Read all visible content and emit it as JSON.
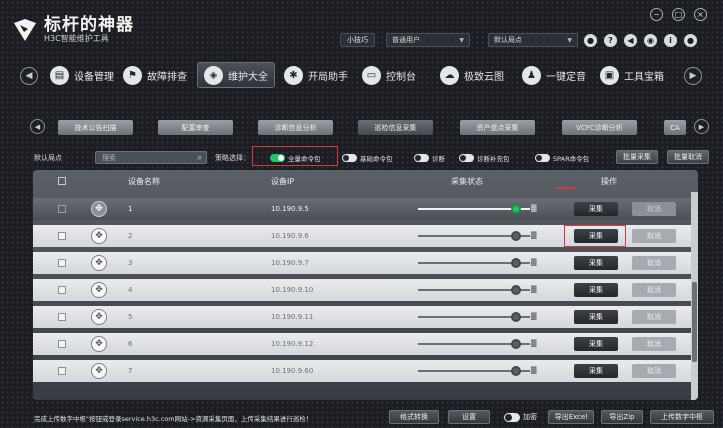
{
  "app": {
    "title": "标杆的神器",
    "subtitle": "H3C智能维护工具"
  },
  "header": {
    "tip_button": "小技巧",
    "user_select": "普通用户",
    "site_select": "默认局点",
    "window_controls": [
      "⊖",
      "⊕",
      "⊗"
    ],
    "icons": [
      "person-icon",
      "help-icon",
      "back-icon",
      "settings-icon",
      "info-icon",
      "pin-icon"
    ]
  },
  "nav": {
    "items": [
      {
        "label": "设备管理",
        "icon": "device-icon"
      },
      {
        "label": "故障排查",
        "icon": "troubleshoot-icon"
      },
      {
        "label": "维护大全",
        "icon": "shield-icon",
        "active": true
      },
      {
        "label": "开局助手",
        "icon": "gear-icon"
      },
      {
        "label": "控制台",
        "icon": "console-icon"
      },
      {
        "label": "极致云图",
        "icon": "cloud-icon"
      },
      {
        "label": "一键定音",
        "icon": "person-icon"
      },
      {
        "label": "工具宝箱",
        "icon": "toolbox-icon"
      }
    ]
  },
  "subtabs": [
    {
      "label": "技术公告扫描"
    },
    {
      "label": "配置审查"
    },
    {
      "label": "诊断信息分析"
    },
    {
      "label": "巡检信息采集",
      "active": true
    },
    {
      "label": "资产盘点采集"
    },
    {
      "label": "VCFC诊断分析"
    },
    {
      "label": "CA"
    }
  ],
  "filter": {
    "site_label": "默认局点",
    "search_placeholder": "搜索",
    "strategy_label": "策略选择：",
    "toggles": [
      {
        "label": "全量命令包",
        "on": true
      },
      {
        "label": "基础命令包",
        "on": false
      },
      {
        "label": "诊断",
        "on": false
      },
      {
        "label": "诊断补充包",
        "on": false
      },
      {
        "label": "SPAR命令包",
        "on": false
      }
    ],
    "batch_collect": "批量采集",
    "batch_cancel": "批量取消"
  },
  "table": {
    "headers": {
      "name": "设备名称",
      "ip": "设备IP",
      "status": "采集状态",
      "action": "操作"
    },
    "rows": [
      {
        "name": "1",
        "ip": "10.190.9.5",
        "collect": "采集",
        "cancel": "取消",
        "selected": true
      },
      {
        "name": "2",
        "ip": "10.190.9.6",
        "collect": "采集",
        "cancel": "取消"
      },
      {
        "name": "3",
        "ip": "10.190.9.7",
        "collect": "采集",
        "cancel": "取消"
      },
      {
        "name": "4",
        "ip": "10.190.9.10",
        "collect": "采集",
        "cancel": "取消"
      },
      {
        "name": "5",
        "ip": "10.190.9.11",
        "collect": "采集",
        "cancel": "取消"
      },
      {
        "name": "6",
        "ip": "10.190.9.12",
        "collect": "采集",
        "cancel": "取消"
      },
      {
        "name": "7",
        "ip": "10.190.9.60",
        "collect": "采集",
        "cancel": "取消"
      }
    ]
  },
  "footer": {
    "hint": "完成上传数字中枢\"按钮或登录service.h3c.com网站->资源采集页面，上传采集结果进行巡检！",
    "format_convert": "格式转换",
    "settings": "设置",
    "encrypt_label": "加密",
    "export_excel": "导出Excel",
    "export_zip": "导出Zip",
    "upload_hub": "上传数字中枢"
  },
  "colors": {
    "accent_green": "#22c55e",
    "highlight_red": "#d43a3a"
  }
}
